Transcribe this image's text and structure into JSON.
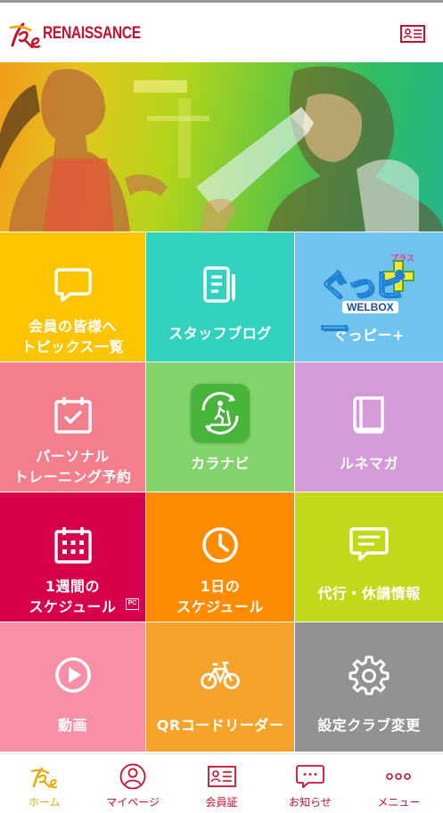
{
  "header": {
    "brand_text": "RENAISSANCE",
    "brand_color": "#c8102e"
  },
  "tiles": [
    {
      "label": "会員の皆様へ\nトピックス一覧",
      "color": "#fdc500",
      "icon": "speech-bubble-icon"
    },
    {
      "label": "スタッフブログ",
      "color": "#33d2c0",
      "icon": "document-pen-icon"
    },
    {
      "label": "ぐっピー+",
      "color": "#70c3ef",
      "icon": "welbox-logo",
      "logo_text": "ぐっピー",
      "logo_sub": "WELBOX",
      "logo_plus": "プラス"
    },
    {
      "label": "パーソナル\nトレーニング予約",
      "color": "#f47e8b",
      "icon": "calendar-check-icon"
    },
    {
      "label": "カラナビ",
      "color": "#83d36b",
      "icon": "treadmill-app-icon"
    },
    {
      "label": "ルネマガ",
      "color": "#d59ad9",
      "icon": "book-icon"
    },
    {
      "label": "1週間の\nスケジュール",
      "color": "#d9004b",
      "icon": "calendar-grid-icon",
      "badge": "PC"
    },
    {
      "label": "1日の\nスケジュール",
      "color": "#ff8c00",
      "icon": "clock-icon"
    },
    {
      "label": "代行・休講情報",
      "color": "#c1d81b",
      "icon": "message-icon"
    },
    {
      "label": "動画",
      "color": "#f78fa7",
      "icon": "play-icon"
    },
    {
      "label": "QRコードリーダー",
      "color": "#f5a32a",
      "icon": "bicycle-icon"
    },
    {
      "label": "設定クラブ変更",
      "color": "#929292",
      "icon": "gear-icon"
    }
  ],
  "bottom_nav": [
    {
      "label": "ホーム",
      "icon": "home-logo-icon",
      "active": true
    },
    {
      "label": "マイページ",
      "icon": "person-icon",
      "active": false
    },
    {
      "label": "会員証",
      "icon": "member-card-icon",
      "active": false
    },
    {
      "label": "お知らせ",
      "icon": "notification-bubble-icon",
      "active": false
    },
    {
      "label": "メニュー",
      "icon": "more-dots-icon",
      "active": false
    }
  ]
}
